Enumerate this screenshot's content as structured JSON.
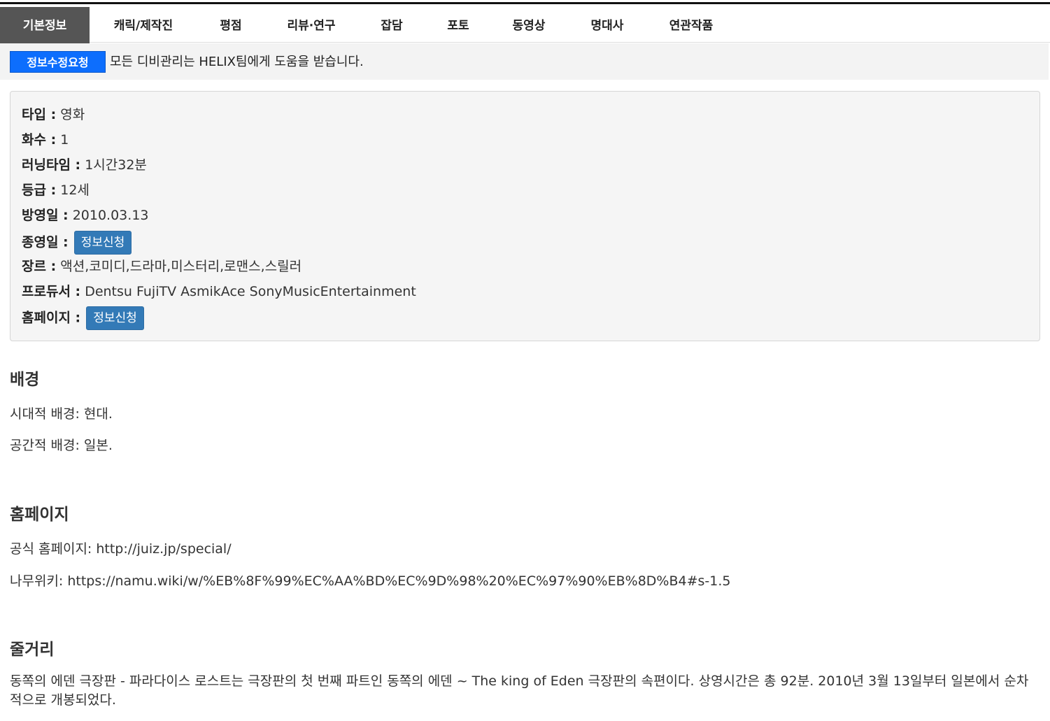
{
  "tabs": [
    {
      "label": "기본정보"
    },
    {
      "label": "캐릭/제작진"
    },
    {
      "label": "평점"
    },
    {
      "label": "리뷰·연구"
    },
    {
      "label": "잡담"
    },
    {
      "label": "포토"
    },
    {
      "label": "동영상"
    },
    {
      "label": "명대사"
    },
    {
      "label": "연관작품"
    }
  ],
  "notice": {
    "button": "정보수정요청",
    "text": "모든 디비관리는 HELIX팀에게 도움을 받습니다."
  },
  "info": {
    "type": {
      "key": "타입 :",
      "value": "영화"
    },
    "episodes": {
      "key": "화수 :",
      "value": "1"
    },
    "runtime": {
      "key": "러닝타임 :",
      "value": "1시간32분"
    },
    "rating": {
      "key": "등급 :",
      "value": "12세"
    },
    "release": {
      "key": "방영일 :",
      "value": "2010.03.13"
    },
    "end": {
      "key": "종영일 :",
      "button": "정보신청"
    },
    "genre": {
      "key": "장르 :",
      "value": "액션,코미디,드라마,미스터리,로맨스,스릴러"
    },
    "producer": {
      "key": "프로듀서 :",
      "value": "Dentsu FujiTV AsmikAce SonyMusicEntertainment"
    },
    "homepage": {
      "key": "홈페이지 :",
      "button": "정보신청"
    }
  },
  "background": {
    "title": "배경",
    "lines": [
      "시대적 배경: 현대.",
      "공간적 배경: 일본."
    ]
  },
  "homepage_section": {
    "title": "홈페이지",
    "lines": [
      "공식 홈페이지: http://juiz.jp/special/",
      "나무위키: https://namu.wiki/w/%EB%8F%99%EC%AA%BD%EC%9D%98%20%EC%97%90%EB%8D%B4#s-1.5"
    ]
  },
  "synopsis": {
    "title": "줄거리",
    "text": "동쪽의 에덴 극장판 - 파라다이스 로스트는 극장판의 첫 번째 파트인 동쪽의 에덴 ~ The king of Eden 극장판의 속편이다. 상영시간은 총 92분. 2010년 3월 13일부터 일본에서 순차적으로 개봉되었다."
  }
}
